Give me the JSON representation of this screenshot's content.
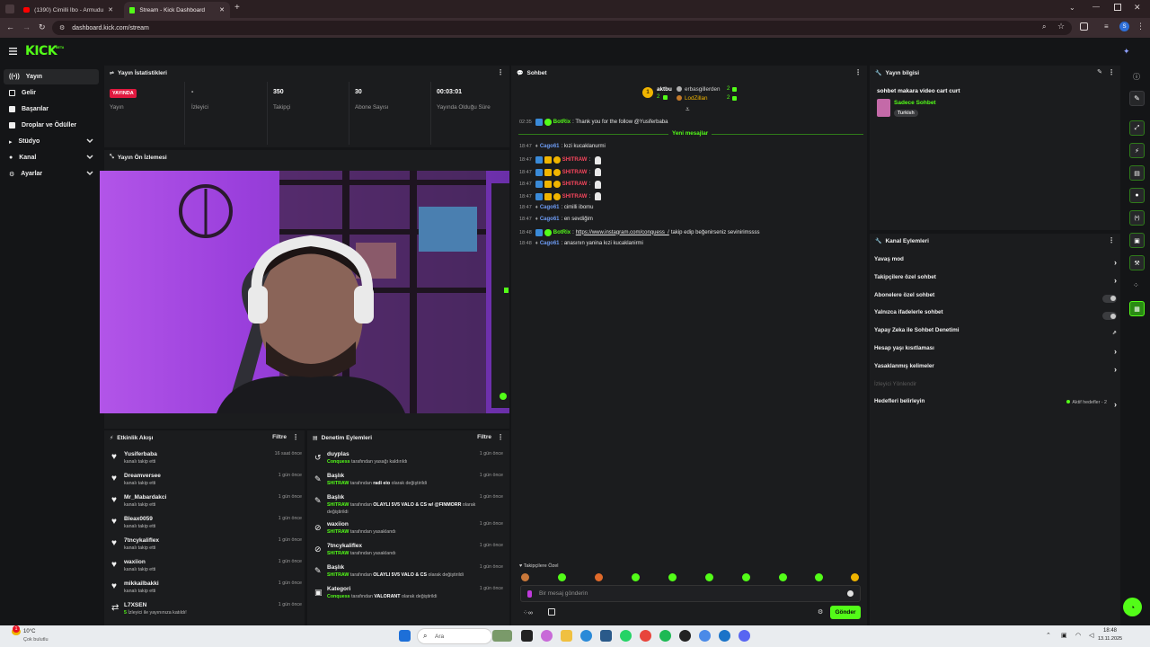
{
  "browser": {
    "tabs": [
      {
        "title": "(1390) Cimilli İbo - Armudu Bu...",
        "active": false
      },
      {
        "title": "Stream - Kick Dashboard",
        "active": true
      }
    ],
    "url": "dashboard.kick.com/stream",
    "profile_initial": "S"
  },
  "app": {
    "logo": "KICK",
    "logo_suffix": "BETA",
    "brand_color": "#53fc18"
  },
  "sidebar": {
    "items": [
      {
        "label": "Yayın",
        "icon": "broadcast-icon",
        "active": true,
        "expandable": false
      },
      {
        "label": "Gelir",
        "icon": "revenue-icon",
        "active": false,
        "expandable": false
      },
      {
        "label": "Başarılar",
        "icon": "achievements-icon",
        "active": false,
        "expandable": false
      },
      {
        "label": "Droplar ve Ödüller",
        "icon": "gift-icon",
        "active": false,
        "expandable": false
      },
      {
        "label": "Stüdyo",
        "icon": "studio-icon",
        "active": false,
        "expandable": true
      },
      {
        "label": "Kanal",
        "icon": "user-icon",
        "active": false,
        "expandable": true
      },
      {
        "label": "Ayarlar",
        "icon": "gear-icon",
        "active": false,
        "expandable": true
      }
    ]
  },
  "stats": {
    "title": "Yayın İstatistikleri",
    "live_badge": "YAYINDA",
    "items": [
      {
        "value": "",
        "label": "Yayın"
      },
      {
        "value": "-",
        "label": "İzleyici"
      },
      {
        "value": "350",
        "label": "Takipçi"
      },
      {
        "value": "30",
        "label": "Abone Sayısı"
      },
      {
        "value": "00:03:01",
        "label": "Yayında Olduğu Süre"
      }
    ]
  },
  "preview": {
    "title": "Yayın Ön İzlemesi"
  },
  "activity": {
    "title": "Etkinlik Akışı",
    "filter": "Filtre",
    "items": [
      {
        "name": "Yusiferbaba",
        "sub": "kanalı takip etti",
        "time": "16 saat önce",
        "icon": "heart-icon"
      },
      {
        "name": "Dreamversee",
        "sub": "kanalı takip etti",
        "time": "1 gün önce",
        "icon": "heart-icon"
      },
      {
        "name": "Mr_Mabardakci",
        "sub": "kanalı takip etti",
        "time": "1 gün önce",
        "icon": "heart-icon"
      },
      {
        "name": "Bleax0059",
        "sub": "kanalı takip etti",
        "time": "1 gün önce",
        "icon": "heart-icon"
      },
      {
        "name": "7tncykaliflex",
        "sub": "kanalı takip etti",
        "time": "1 gün önce",
        "icon": "heart-icon"
      },
      {
        "name": "waxiion",
        "sub": "kanalı takip etti",
        "time": "1 gün önce",
        "icon": "heart-icon"
      },
      {
        "name": "mikkailbakki",
        "sub": "kanalı takip etti",
        "time": "1 gün önce",
        "icon": "heart-icon"
      },
      {
        "name": "L7XSEN",
        "sub_green": "5",
        "sub": " İzleyici ile yayınınıza katıldı!",
        "time": "1 gün önce",
        "icon": "raid-icon"
      }
    ]
  },
  "moderation": {
    "title": "Denetim Eylemleri",
    "filter": "Filtre",
    "items": [
      {
        "name": "duyplas",
        "actor": "Conquess",
        "text": " tarafından yasağı kaldırıldı",
        "time": "1 gün önce",
        "icon": "undo-icon"
      },
      {
        "name": "Başlık",
        "actor": "SHITRAW",
        "text": " tarafından ",
        "bold": "radi eio",
        "tail": " olarak değiştirildi",
        "time": "1 gün önce",
        "icon": "edit-icon"
      },
      {
        "name": "Başlık",
        "actor": "SHITRAW",
        "text": " tarafından ",
        "bold": "OLAYLI 5V5 VALO & CS w/ @FINMORR",
        "tail": " olarak",
        "line2": "değiştirildi",
        "time": "1 gün önce",
        "icon": "edit-icon"
      },
      {
        "name": "waxiion",
        "actor": "SHITRAW",
        "text": " tarafından yasaklandı",
        "time": "1 gün önce",
        "icon": "ban-icon"
      },
      {
        "name": "7tncykaliflex",
        "actor": "SHITRAW",
        "text": " tarafından yasaklandı",
        "time": "1 gün önce",
        "icon": "ban-icon"
      },
      {
        "name": "Başlık",
        "actor": "SHITRAW",
        "text": " tarafından ",
        "bold": "OLAYLI 5V5 VALO & CS",
        "tail": " olarak değiştirildi",
        "time": "1 gün önce",
        "icon": "edit-icon"
      },
      {
        "name": "Kategori",
        "actor": "Conquess",
        "text": " tarafından ",
        "bold": "VALORANT",
        "tail": " olarak değiştirildi",
        "time": "1 gün önce",
        "icon": "category-icon"
      }
    ]
  },
  "chat": {
    "title": "Sohbet",
    "leaderboard": [
      {
        "name": "aktbu",
        "count": "2"
      },
      {
        "name": "erbasgillerden",
        "count": "2"
      },
      {
        "name": "LodZillan",
        "count": "2"
      }
    ],
    "new_messages": "Yeni mesajlar",
    "pinned": {
      "time": "02:35",
      "user": "BotRix",
      "text": ": Thank you for the follow @Yusiferbaba"
    },
    "messages": [
      {
        "time": "18:47",
        "user": "Cago61",
        "text": ": kızi kucaklanurmi",
        "color": "#6e9cf5",
        "badges": "mod"
      },
      {
        "time": "18:47",
        "user": "SHITRAW",
        "text": ":",
        "color": "#f5455c",
        "badges": "full",
        "emote": true
      },
      {
        "time": "18:47",
        "user": "SHITRAW",
        "text": ":",
        "color": "#f5455c",
        "badges": "full",
        "emote": true
      },
      {
        "time": "18:47",
        "user": "SHITRAW",
        "text": ":",
        "color": "#f5455c",
        "badges": "full",
        "emote": true
      },
      {
        "time": "18:47",
        "user": "SHITRAW",
        "text": ":",
        "color": "#f5455c",
        "badges": "full",
        "emote": true
      },
      {
        "time": "18:47",
        "user": "Cago61",
        "text": ": cimilli ibomu",
        "color": "#6e9cf5",
        "badges": "mod"
      },
      {
        "time": "18:47",
        "user": "Cago61",
        "text": ": en sevdiğim",
        "color": "#6e9cf5",
        "badges": "mod"
      },
      {
        "time": "18:48",
        "user": "BotRix",
        "link": "https://www.instagram.com/conquess_/",
        "text": " takip edip beğenirseniz sevinirimssss",
        "color": "#53fc18",
        "badges": "bot"
      },
      {
        "time": "18:48",
        "user": "Cago61",
        "text": ": anasının yanina kızi kucaklanirmi",
        "color": "#6e9cf5",
        "badges": "mod"
      }
    ],
    "followers_only": "Takipçilere Özel",
    "input_placeholder": "Bir mesaj gönderin",
    "send": "Gönder"
  },
  "stream_info": {
    "title": "Yayın bilgisi",
    "stream_title": "sohbet makara video cart curt",
    "category": "Sadece Sohbet",
    "tag": "Turkish"
  },
  "channel_actions": {
    "title": "Kanal Eylemleri",
    "rows": [
      {
        "label": "Yavaş mod",
        "control": "chevron"
      },
      {
        "label": "Takipçilere özel sohbet",
        "control": "chevron"
      },
      {
        "label": "Abonelere özel sohbet",
        "control": "toggle"
      },
      {
        "label": "Yalnızca ifadelerle sohbet",
        "control": "toggle"
      },
      {
        "label": "Yapay Zeka ile Sohbet Denetimi",
        "control": "external"
      },
      {
        "label": "Hesap yaşı kısıtlaması",
        "control": "chevron"
      },
      {
        "label": "Yasaklanmış kelimeler",
        "control": "chevron"
      },
      {
        "label": "İzleyici Yönlendir",
        "control": "none",
        "disabled": true
      },
      {
        "label": "Hedefleri belirleyin",
        "control": "chevron",
        "status": "Aktif hedefler - 2"
      }
    ]
  },
  "taskbar": {
    "weather_temp": "10°C",
    "weather_text": "Çok bulutlu",
    "notif_count": "1",
    "search": "Ara",
    "time": "18:48",
    "date": "13.11.2025"
  }
}
